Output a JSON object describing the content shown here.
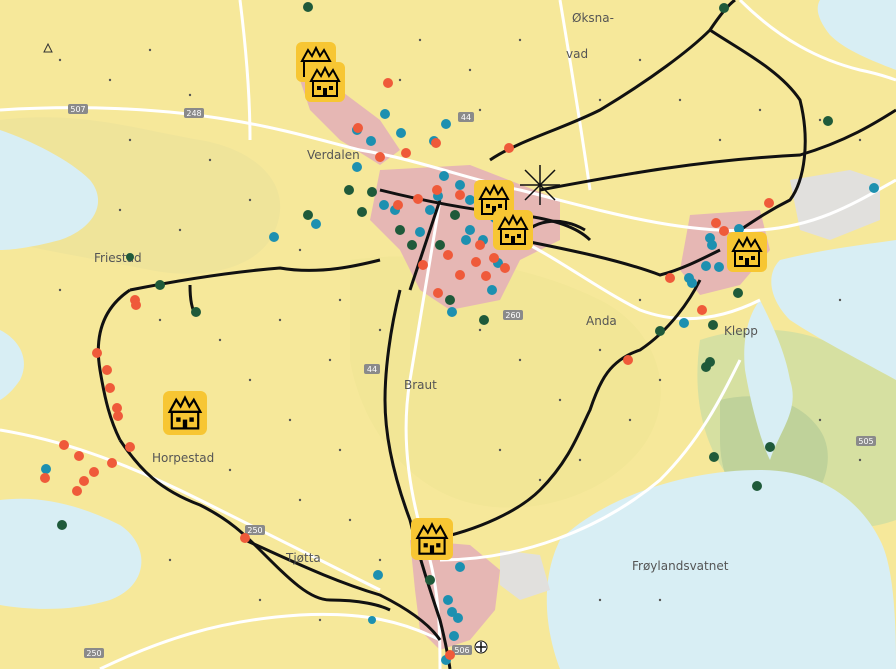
{
  "map": {
    "colors": {
      "land": "#f6e89a",
      "land_alt": "#ece7a6",
      "water": "#d8eef4",
      "urban": "#e6b7b4",
      "road": "#ffffff",
      "route": "#111111",
      "marker_red": "#ef5a3a",
      "marker_blue": "#1d90b0",
      "marker_dark": "#1f5a3a",
      "house_fill": "#f7c633",
      "house_stroke": "#000000"
    },
    "place_labels": [
      {
        "name": "Øksna-",
        "icon": "text"
      },
      {
        "name": "vad",
        "icon": "text"
      },
      {
        "name": "Verdalen",
        "icon": "text"
      },
      {
        "name": "Friestad",
        "icon": "text"
      },
      {
        "name": "Anda",
        "icon": "text"
      },
      {
        "name": "Klepp",
        "icon": "text"
      },
      {
        "name": "Braut",
        "icon": "text"
      },
      {
        "name": "Horpestad",
        "icon": "text"
      },
      {
        "name": "Tjøtta",
        "icon": "text"
      },
      {
        "name": "Frøylandsvatnet",
        "icon": "text"
      }
    ],
    "road_shields": [
      "507",
      "248",
      "44",
      "260",
      "44",
      "250",
      "505",
      "250",
      "506"
    ],
    "house_icon": "house-marker-icon",
    "church_icon": "church-cross-icon"
  }
}
